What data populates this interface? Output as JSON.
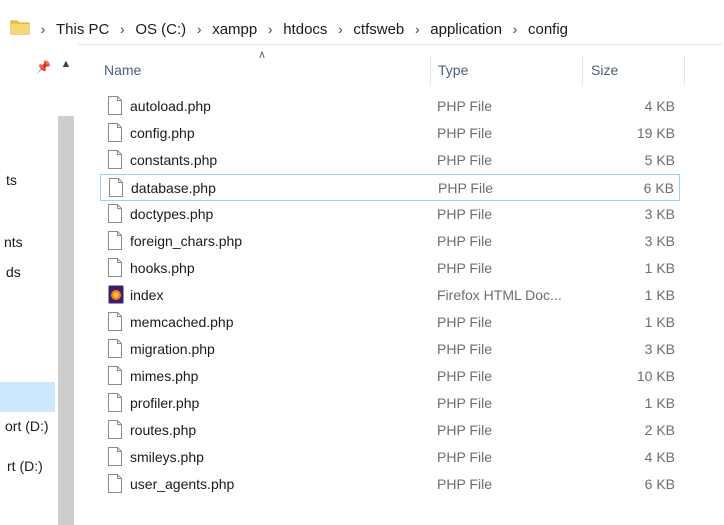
{
  "breadcrumb": {
    "items": [
      "This PC",
      "OS (C:)",
      "xampp",
      "htdocs",
      "ctfsweb",
      "application",
      "config"
    ]
  },
  "nav": {
    "items": [
      "ts",
      "nts",
      "ds",
      "ort (D:)",
      "rt (D:)"
    ]
  },
  "columns": {
    "name": "Name",
    "type": "Type",
    "size": "Size"
  },
  "files": [
    {
      "name": "autoload.php",
      "type": "PHP File",
      "size": "4 KB",
      "icon": "document-icon"
    },
    {
      "name": "config.php",
      "type": "PHP File",
      "size": "19 KB",
      "icon": "document-icon"
    },
    {
      "name": "constants.php",
      "type": "PHP File",
      "size": "5 KB",
      "icon": "document-icon"
    },
    {
      "name": "database.php",
      "type": "PHP File",
      "size": "6 KB",
      "icon": "document-icon"
    },
    {
      "name": "doctypes.php",
      "type": "PHP File",
      "size": "3 KB",
      "icon": "document-icon"
    },
    {
      "name": "foreign_chars.php",
      "type": "PHP File",
      "size": "3 KB",
      "icon": "document-icon"
    },
    {
      "name": "hooks.php",
      "type": "PHP File",
      "size": "1 KB",
      "icon": "document-icon"
    },
    {
      "name": "index",
      "type": "Firefox HTML Doc...",
      "size": "1 KB",
      "icon": "firefox-icon"
    },
    {
      "name": "memcached.php",
      "type": "PHP File",
      "size": "1 KB",
      "icon": "document-icon"
    },
    {
      "name": "migration.php",
      "type": "PHP File",
      "size": "3 KB",
      "icon": "document-icon"
    },
    {
      "name": "mimes.php",
      "type": "PHP File",
      "size": "10 KB",
      "icon": "document-icon"
    },
    {
      "name": "profiler.php",
      "type": "PHP File",
      "size": "1 KB",
      "icon": "document-icon"
    },
    {
      "name": "routes.php",
      "type": "PHP File",
      "size": "2 KB",
      "icon": "document-icon"
    },
    {
      "name": "smileys.php",
      "type": "PHP File",
      "size": "4 KB",
      "icon": "document-icon"
    },
    {
      "name": "user_agents.php",
      "type": "PHP File",
      "size": "6 KB",
      "icon": "document-icon"
    }
  ],
  "selected_file": "database.php",
  "colors": {
    "selection_border": "#99d1ff",
    "header_text": "#4c607a",
    "secondary_text": "#6d6d6d"
  }
}
